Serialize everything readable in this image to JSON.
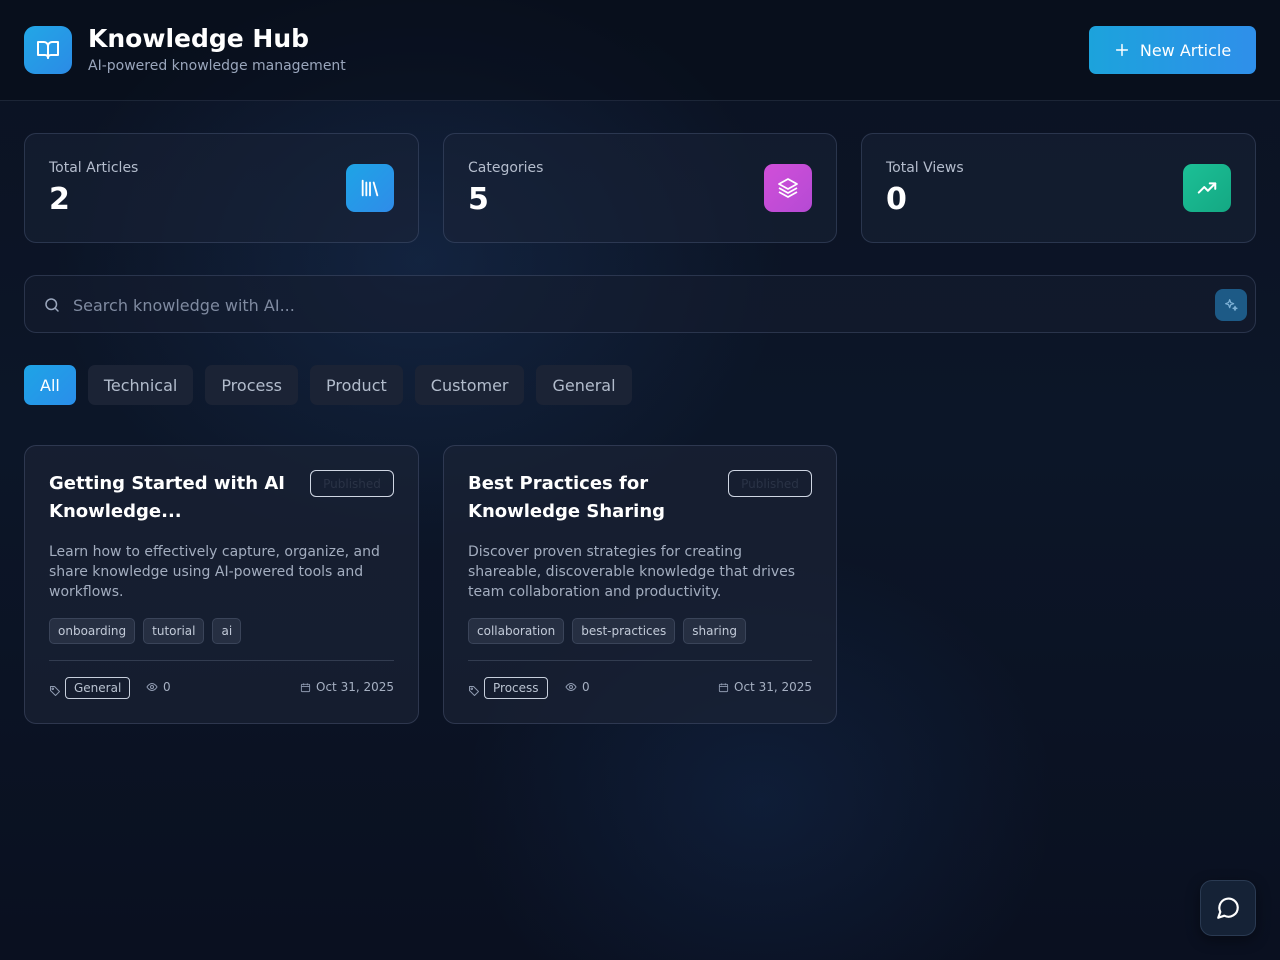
{
  "header": {
    "title": "Knowledge Hub",
    "subtitle": "AI-powered knowledge management",
    "new_button_label": "New Article"
  },
  "stats": [
    {
      "label": "Total Articles",
      "value": "2",
      "icon": "library-icon",
      "color": "#2196e8"
    },
    {
      "label": "Categories",
      "value": "5",
      "icon": "layers-icon",
      "color": "#c64bd6"
    },
    {
      "label": "Total Views",
      "value": "0",
      "icon": "trending-up-icon",
      "color": "#19b28e"
    }
  ],
  "search": {
    "placeholder": "Search knowledge with AI...",
    "value": ""
  },
  "filters": [
    "All",
    "Technical",
    "Process",
    "Product",
    "Customer",
    "General"
  ],
  "active_filter": "All",
  "articles": [
    {
      "title": "Getting Started with AI Knowledge...",
      "status": "Published",
      "description": "Learn how to effectively capture, organize, and share knowledge using AI-powered tools and workflows.",
      "tags": [
        "onboarding",
        "tutorial",
        "ai"
      ],
      "category": "General",
      "views": "0",
      "date": "Oct 31, 2025"
    },
    {
      "title": "Best Practices for Knowledge Sharing",
      "status": "Published",
      "description": "Discover proven strategies for creating shareable, discoverable knowledge that drives team collaboration and productivity.",
      "tags": [
        "collaboration",
        "best-practices",
        "sharing"
      ],
      "category": "Process",
      "views": "0",
      "date": "Oct 31, 2025"
    }
  ],
  "colors": {
    "accent": "#1ea4e6",
    "background": "#0c1628"
  }
}
